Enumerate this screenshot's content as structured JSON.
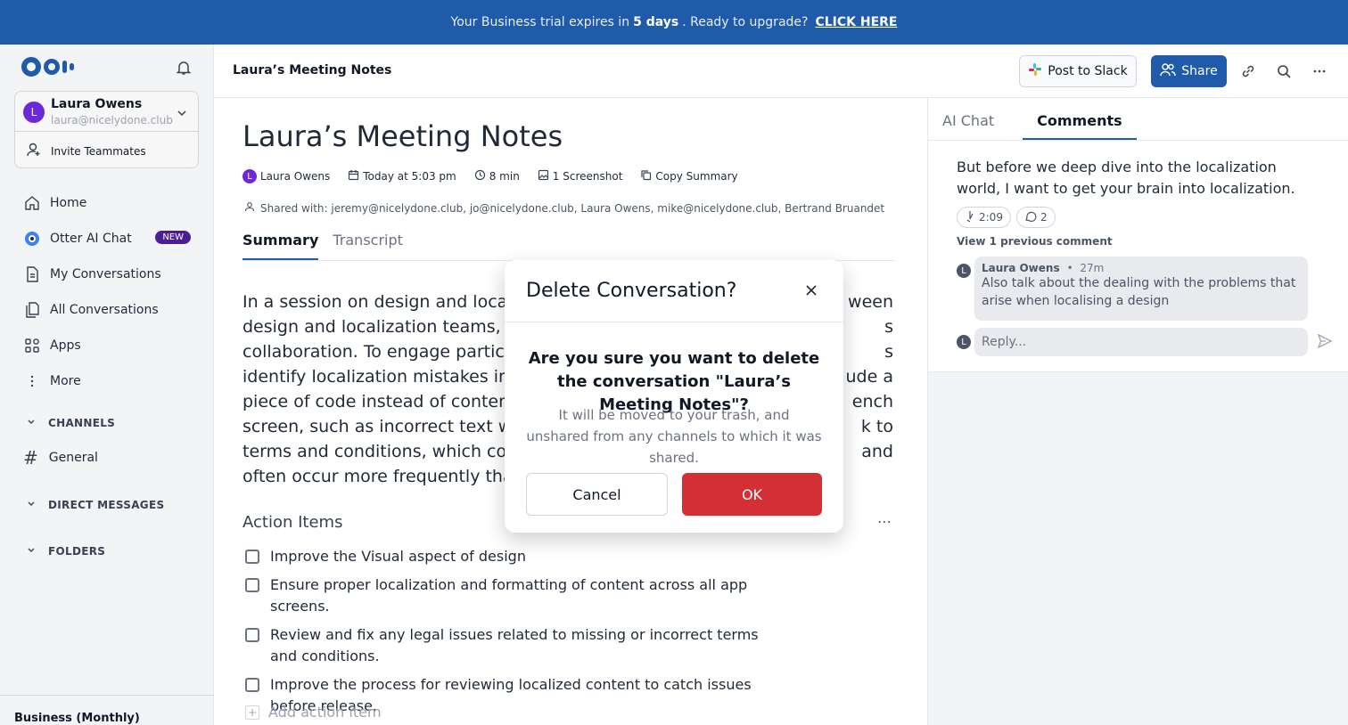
{
  "banner": {
    "prefix": "Your Business trial expires in",
    "days": "5 days",
    "suffix": ". Ready to upgrade?",
    "cta": "CLICK HERE",
    "color": "#1f5ba8"
  },
  "sidebar": {
    "account": {
      "initial": "L",
      "name": "Laura Owens",
      "email": "laura@nicelydone.club"
    },
    "invite_label": "Invite Teammates",
    "nav": [
      {
        "label": "Home",
        "icon": "home-icon"
      },
      {
        "label": "Otter AI Chat",
        "icon": "otter-ai-icon",
        "badge": "NEW"
      },
      {
        "label": "My Conversations",
        "icon": "document-icon"
      },
      {
        "label": "All Conversations",
        "icon": "documents-icon"
      },
      {
        "label": "Apps",
        "icon": "apps-icon"
      },
      {
        "label": "More",
        "icon": "more-vertical-icon"
      }
    ],
    "channels_header": "CHANNELS",
    "channel_general": "General",
    "dm_header": "DIRECT MESSAGES",
    "folders_header": "FOLDERS",
    "plan": "Business (Monthly)"
  },
  "header": {
    "title": "Laura’s Meeting Notes",
    "post_slack": "Post to Slack",
    "share": "Share"
  },
  "doc": {
    "title": "Laura’s Meeting Notes",
    "author": "Laura Owens",
    "author_initial": "L",
    "time": "Today at 5:03 pm",
    "duration": "8 min",
    "screenshots": "1 Screenshot",
    "copy_summary": "Copy Summary",
    "shared": "Shared with: jeremy@nicelydone.club, jo@nicelydone.club, Laura Owens, mike@nicelydone.club, Bertrand Bruandet",
    "tabs": [
      "Summary",
      "Transcript"
    ],
    "summary_lines": [
      "In a session on design and localizat",
      "design and localization teams, high",
      "collaboration. To engage participan",
      "identify localization mistakes in a D",
      "piece of code instead of content on",
      "screen, such as incorrect text wrapp",
      "terms and conditions, which could b",
      "often occur more frequently than ex"
    ],
    "summary_right": [
      "ween",
      "s",
      "s",
      "ude a",
      "ench",
      "k to",
      "and",
      ""
    ],
    "action_items_heading": "Action Items",
    "action_items": [
      "Improve the Visual aspect of design",
      "Ensure proper localization and formatting of content across all app screens.",
      "Review and fix any legal issues related to missing or incorrect terms and conditions.",
      "Improve the process for reviewing localized content to catch issues before release."
    ],
    "add_action": "Add action item"
  },
  "right_panel": {
    "tabs": [
      "AI Chat",
      "Comments"
    ],
    "quote": "But before we deep dive into the localization world, I want to get your brain into localization.",
    "audio_time": "2:09",
    "comment_count": "2",
    "view_previous": "View 1 previous comment",
    "reply": {
      "initial": "L",
      "author": "Laura Owens",
      "time": "27m",
      "text": "Also talk about the dealing with the problems that arise when localising a design"
    },
    "reply_placeholder": "Reply..."
  },
  "modal": {
    "title": "Delete Conversation?",
    "question": "Are you sure you want to delete the conversation \"Laura’s Meeting Notes\"?",
    "sub": "It will be moved to your trash, and unshared from any channels to which it was shared.",
    "cancel": "Cancel",
    "ok": "OK",
    "ok_color": "#d32f34"
  }
}
